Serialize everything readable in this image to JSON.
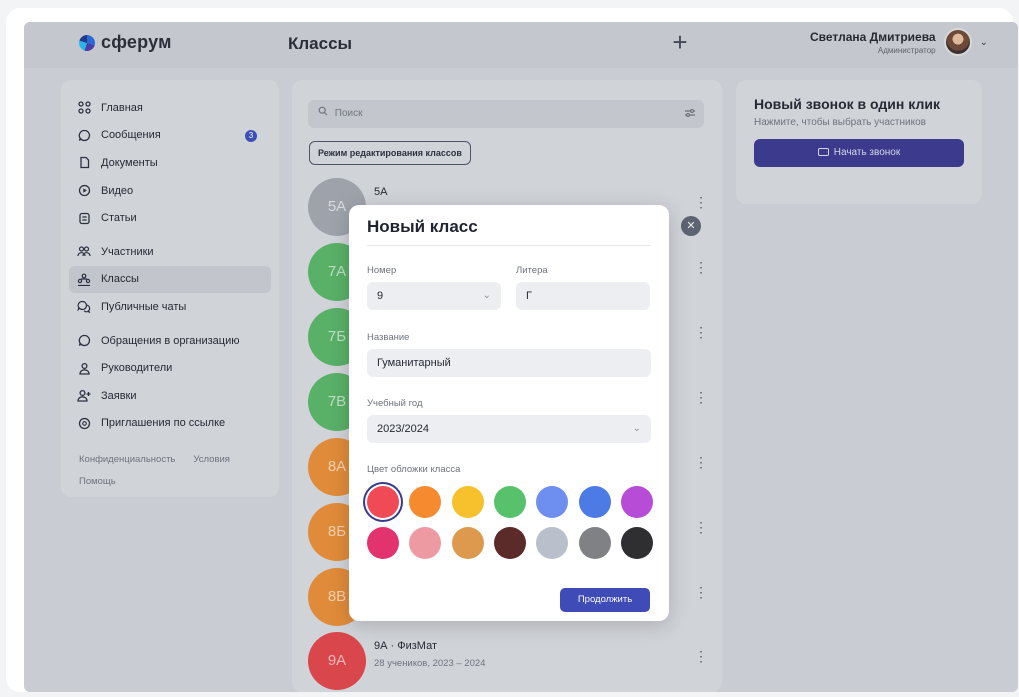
{
  "header": {
    "logo_text": "сферум",
    "page_title": "Классы",
    "plus_label": "+",
    "user_name": "Светлана Дмитриева",
    "user_role": "Администратор"
  },
  "sidebar": {
    "items": [
      {
        "label": "Главная",
        "icon": "grid-icon"
      },
      {
        "label": "Сообщения",
        "icon": "chat-icon",
        "badge": "3"
      },
      {
        "label": "Документы",
        "icon": "document-icon"
      },
      {
        "label": "Видео",
        "icon": "video-icon"
      },
      {
        "label": "Статьи",
        "icon": "article-icon"
      },
      {
        "label": "Участники",
        "icon": "people-icon"
      },
      {
        "label": "Классы",
        "icon": "classes-icon",
        "active": true
      },
      {
        "label": "Публичные чаты",
        "icon": "public-chat-icon"
      },
      {
        "label": "Обращения в организацию",
        "icon": "appeal-icon"
      },
      {
        "label": "Руководители",
        "icon": "manager-icon"
      },
      {
        "label": "Заявки",
        "icon": "add-person-icon"
      },
      {
        "label": "Приглашения по ссылке",
        "icon": "link-invite-icon"
      }
    ],
    "footer": {
      "privacy": "Конфиденциальность",
      "terms": "Условия",
      "help": "Помощь"
    }
  },
  "list": {
    "search_placeholder": "Поиск",
    "edit_mode_label": "Режим редактирования классов",
    "rows": [
      {
        "avatar_text": "5А",
        "title": "5А",
        "subtitle": "",
        "color": "#9ea3ab"
      },
      {
        "avatar_text": "7А",
        "title": "",
        "subtitle": "",
        "color": "#59b067"
      },
      {
        "avatar_text": "7Б",
        "title": "",
        "subtitle": "",
        "color": "#59b067"
      },
      {
        "avatar_text": "7В",
        "title": "",
        "subtitle": "",
        "color": "#59b067"
      },
      {
        "avatar_text": "8А",
        "title": "",
        "subtitle": "",
        "color": "#e08b3a"
      },
      {
        "avatar_text": "8Б",
        "title": "",
        "subtitle": "",
        "color": "#e08b3a"
      },
      {
        "avatar_text": "8В",
        "title": "",
        "subtitle": "",
        "color": "#e08b3a"
      },
      {
        "avatar_text": "9А",
        "title": "9А · ФизМат",
        "subtitle": "28 учеников, 2023 – 2024",
        "color": "#d9464c"
      }
    ]
  },
  "call": {
    "title": "Новый звонок в один клик",
    "subtitle": "Нажмите, чтобы выбрать участников",
    "button": "Начать звонок"
  },
  "modal": {
    "title": "Новый класс",
    "number_label": "Номер",
    "number_value": "9",
    "letter_label": "Литера",
    "letter_value": "Г",
    "name_label": "Название",
    "name_value": "Гуманитарный",
    "year_label": "Учебный год",
    "year_value": "2023/2024",
    "color_label": "Цвет обложки класса",
    "continue_label": "Продолжить",
    "colors": [
      "#ef4a55",
      "#f58a2e",
      "#f6c12c",
      "#57c16c",
      "#6f8ff0",
      "#4c7be6",
      "#b74cd6",
      "#e2336f",
      "#ee9aa2",
      "#dd9a4e",
      "#5b2b2a",
      "#b9c0cb",
      "#7f8184",
      "#2f2f31"
    ],
    "selected_color_index": 0
  }
}
